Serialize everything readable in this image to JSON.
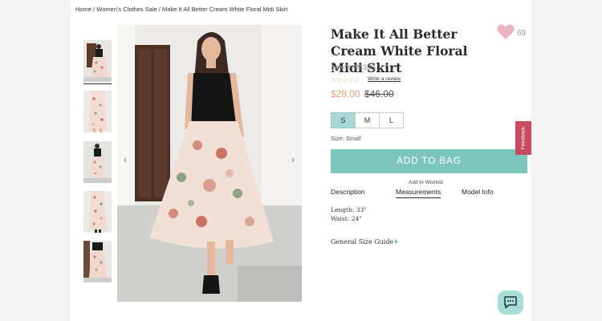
{
  "breadcrumb": {
    "home": "Home",
    "category": "Women's Clothes Sale",
    "current": "Make It All Better Cream White Floral Midi Skirt",
    "separator": " / "
  },
  "product": {
    "title": "Make It All Better Cream White Floral Midi Skirt",
    "likes_count": "69",
    "item_number": "Item #: 94358",
    "rating_stars": "☆☆☆☆☆",
    "write_review": "Write a review",
    "price": "$28.00",
    "original_price": "$46.00"
  },
  "sizes": {
    "options": [
      "S",
      "M",
      "L"
    ],
    "selected": "S",
    "label": "Size: Small"
  },
  "actions": {
    "add_to_bag": "ADD TO BAG",
    "add_to_wishlist": "Add to Wishlist"
  },
  "tabs": {
    "description": "Description",
    "measurements": "Measurements",
    "model_info": "Model Info",
    "active": "Measurements"
  },
  "measurements": {
    "length": "Length: 33\"",
    "waist": "Waist: 24\""
  },
  "size_guide": "General Size Guide",
  "feedback": "Feedback",
  "colors": {
    "accent": "#7cc6be",
    "selected_size": "#a7d8d2",
    "sale_price": "#e2a27c",
    "heart": "#eab3bd",
    "feedback_tab": "#c94a5e",
    "chat": "#a7ddd4"
  },
  "icons": {
    "heart": "heart-icon",
    "prev": "chevron-left-icon",
    "next": "chevron-right-icon",
    "chat": "chat-icon",
    "guide": "triangle-right-icon"
  }
}
